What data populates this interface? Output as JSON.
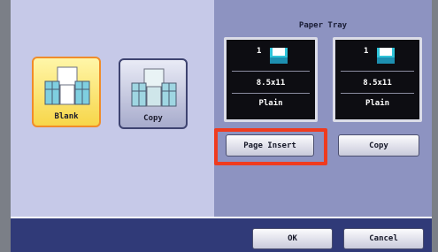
{
  "options": {
    "blank_label": "Blank",
    "copy_label": "Copy",
    "selected": "Blank"
  },
  "paper_tray": {
    "title": "Paper Tray",
    "trays": [
      {
        "number": "1",
        "size": "8.5x11",
        "type": "Plain"
      },
      {
        "number": "1",
        "size": "8.5x11",
        "type": "Plain"
      }
    ]
  },
  "buttons": {
    "page_insert": "Page Insert",
    "copy": "Copy",
    "ok": "OK",
    "cancel": "Cancel"
  },
  "colors": {
    "left_panel": "#c6c9e8",
    "right_panel": "#8d93c1",
    "bottom_bar": "#303a78",
    "selected_option": "#f7d64a",
    "highlight": "#ef3b1f",
    "tray_icon": "#2fc3d8"
  },
  "icons": {
    "blank": "stacked-pages-icon",
    "copy": "stacked-pages-icon",
    "tray": "paper-tray-icon"
  }
}
